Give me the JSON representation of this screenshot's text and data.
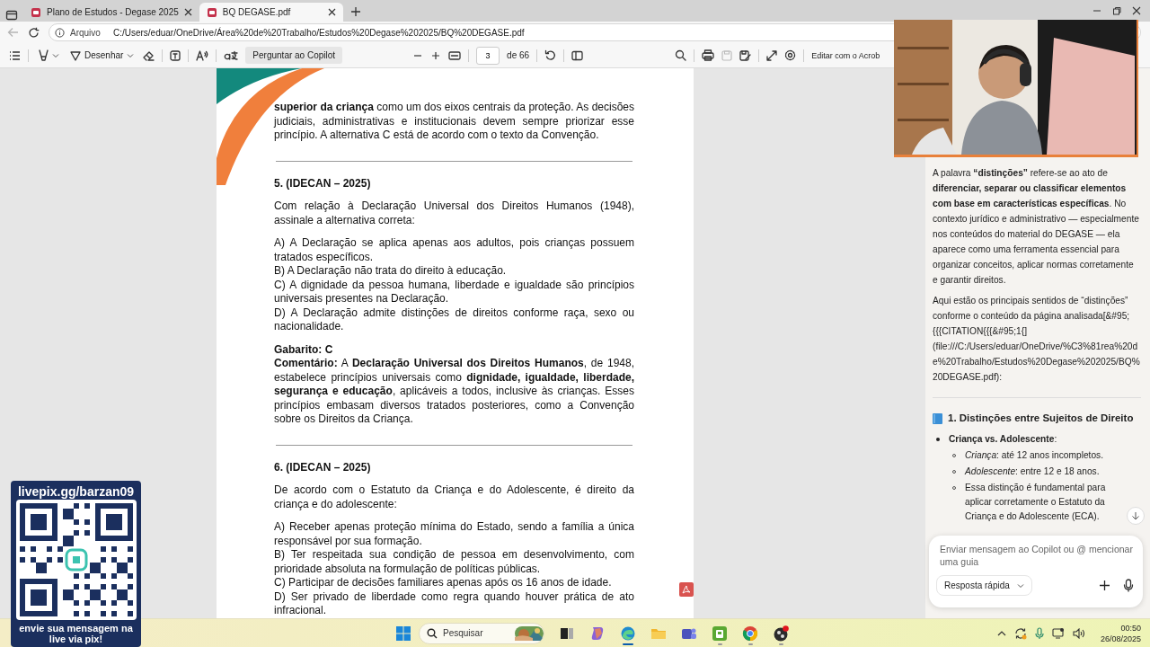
{
  "browser": {
    "tabs": [
      {
        "title": "Plano de Estudos - Degase 2025",
        "selected": false
      },
      {
        "title": "BQ DEGASE.pdf",
        "selected": true
      }
    ],
    "back_disabled": true,
    "address": {
      "scheme": "Arquivo",
      "url": "C:/Users/eduar/OneDrive/Área%20de%20Trabalho/Estudos%20Degase%202025/BQ%20DEGASE.pdf"
    }
  },
  "pdf_toolbar": {
    "draw_label": "Desenhar",
    "copilot_button": "Perguntar ao Copilot",
    "page_number": "3",
    "page_total": "de 66",
    "save_disabled": true,
    "edit_button": "Editar com o Acrob"
  },
  "document": {
    "blocks": [
      {
        "kind": "paragraph",
        "text": "**superior da criança** como um dos eixos centrais da proteção. As decisões judiciais, administrativas e institucionais devem sempre priorizar esse princípio. A alternativa C está de acordo com o texto da Convenção."
      },
      {
        "kind": "rule"
      },
      {
        "kind": "heading",
        "text": "5. (IDECAN – 2025)"
      },
      {
        "kind": "paragraph",
        "text": "Com relação à Declaração Universal dos Direitos Humanos (1948), assinale a alternativa correta:"
      },
      {
        "kind": "paragraph",
        "text": "A) A Declaração se aplica apenas aos adultos, pois crianças possuem tratados específicos."
      },
      {
        "kind": "option",
        "text": "B) A Declaração não trata do direito à educação."
      },
      {
        "kind": "option",
        "text": "C) A dignidade da pessoa humana, liberdade e igualdade são princípios universais presentes na Declaração."
      },
      {
        "kind": "option",
        "text": "D) A Declaração admite distinções de direitos conforme raça, sexo ou nacionalidade."
      },
      {
        "kind": "heading",
        "text": "Gabarito: C"
      },
      {
        "kind": "option",
        "text": "**Comentário:** A **Declaração Universal dos Direitos Humanos**, de 1948, estabelece princípios universais como **dignidade, igualdade, liberdade, segurança e educação**, aplicáveis a todos, inclusive às crianças. Esses princípios embasam diversos tratados posteriores, como a Convenção sobre os Direitos da Criança."
      },
      {
        "kind": "rule"
      },
      {
        "kind": "heading",
        "text": "6. (IDECAN – 2025)"
      },
      {
        "kind": "paragraph",
        "text": "De acordo com o Estatuto da Criança e do Adolescente, é direito da criança e do adolescente:"
      },
      {
        "kind": "paragraph",
        "text": "A) Receber apenas proteção mínima do Estado, sendo a família a única responsável por sua formação."
      },
      {
        "kind": "option",
        "text": "B) Ter respeitada sua condição de pessoa em desenvolvimento, com prioridade absoluta na formulação de políticas públicas."
      },
      {
        "kind": "option",
        "text": "C) Participar de decisões familiares apenas após os 16 anos de idade."
      },
      {
        "kind": "option",
        "text": "D) Ser privado de liberdade como regra quando houver prática de ato infracional."
      }
    ]
  },
  "copilot": {
    "paragraphs": [
      "A palavra **“distinções”** refere-se ao ato de **diferenciar, separar ou classificar elementos com base em características específicas**. No contexto jurídico e administrativo — especialmente nos conteúdos do material do DEGASE — ela aparece como uma ferramenta essencial para organizar conceitos, aplicar normas corretamente e garantir direitos.",
      "Aqui estão os principais sentidos de “distinções” conforme o conteúdo da página analisada[&#95;{{{CITATION{{{&#95;1{](file:///C:/Users/eduar/OneDrive/%C3%81rea%20de%20Trabalho/Estudos%20Degase%202025/BQ%20DEGASE.pdf):"
    ],
    "section_title": "1. Distinções entre Sujeitos de Direito",
    "list": [
      {
        "text": "**Criança vs. Adolescente**:",
        "children": [
          {
            "text": "*Criança*: até 12 anos incompletos."
          },
          {
            "text": "*Adolescente*: entre 12 e 18 anos."
          },
          {
            "text": "Essa distinção é fundamental para aplicar corretamente o Estatuto da Criança e do Adolescente (ECA)."
          }
        ]
      }
    ],
    "composer": {
      "placeholder": "Enviar mensagem ao Copilot ou @ mencionar uma guia",
      "mode_button": "Resposta rápida"
    }
  },
  "donation_overlay": {
    "url": "livepix.gg/barzan09",
    "caption": "envie sua mensagem na live via pix!"
  },
  "taskbar": {
    "search_placeholder": "Pesquisar",
    "apps": [
      {
        "kind": "taskview",
        "active": false,
        "running": false
      },
      {
        "kind": "assistant",
        "active": false,
        "running": false
      },
      {
        "kind": "browser",
        "active": true,
        "running": true
      },
      {
        "kind": "folder",
        "active": false,
        "running": false
      },
      {
        "kind": "chat",
        "active": false,
        "running": false
      },
      {
        "kind": "greenapp",
        "active": false,
        "running": true
      },
      {
        "kind": "globe",
        "active": false,
        "running": true
      },
      {
        "kind": "recorder",
        "active": false,
        "running": true
      }
    ],
    "time": "00:50",
    "date": "26/08/2025"
  }
}
